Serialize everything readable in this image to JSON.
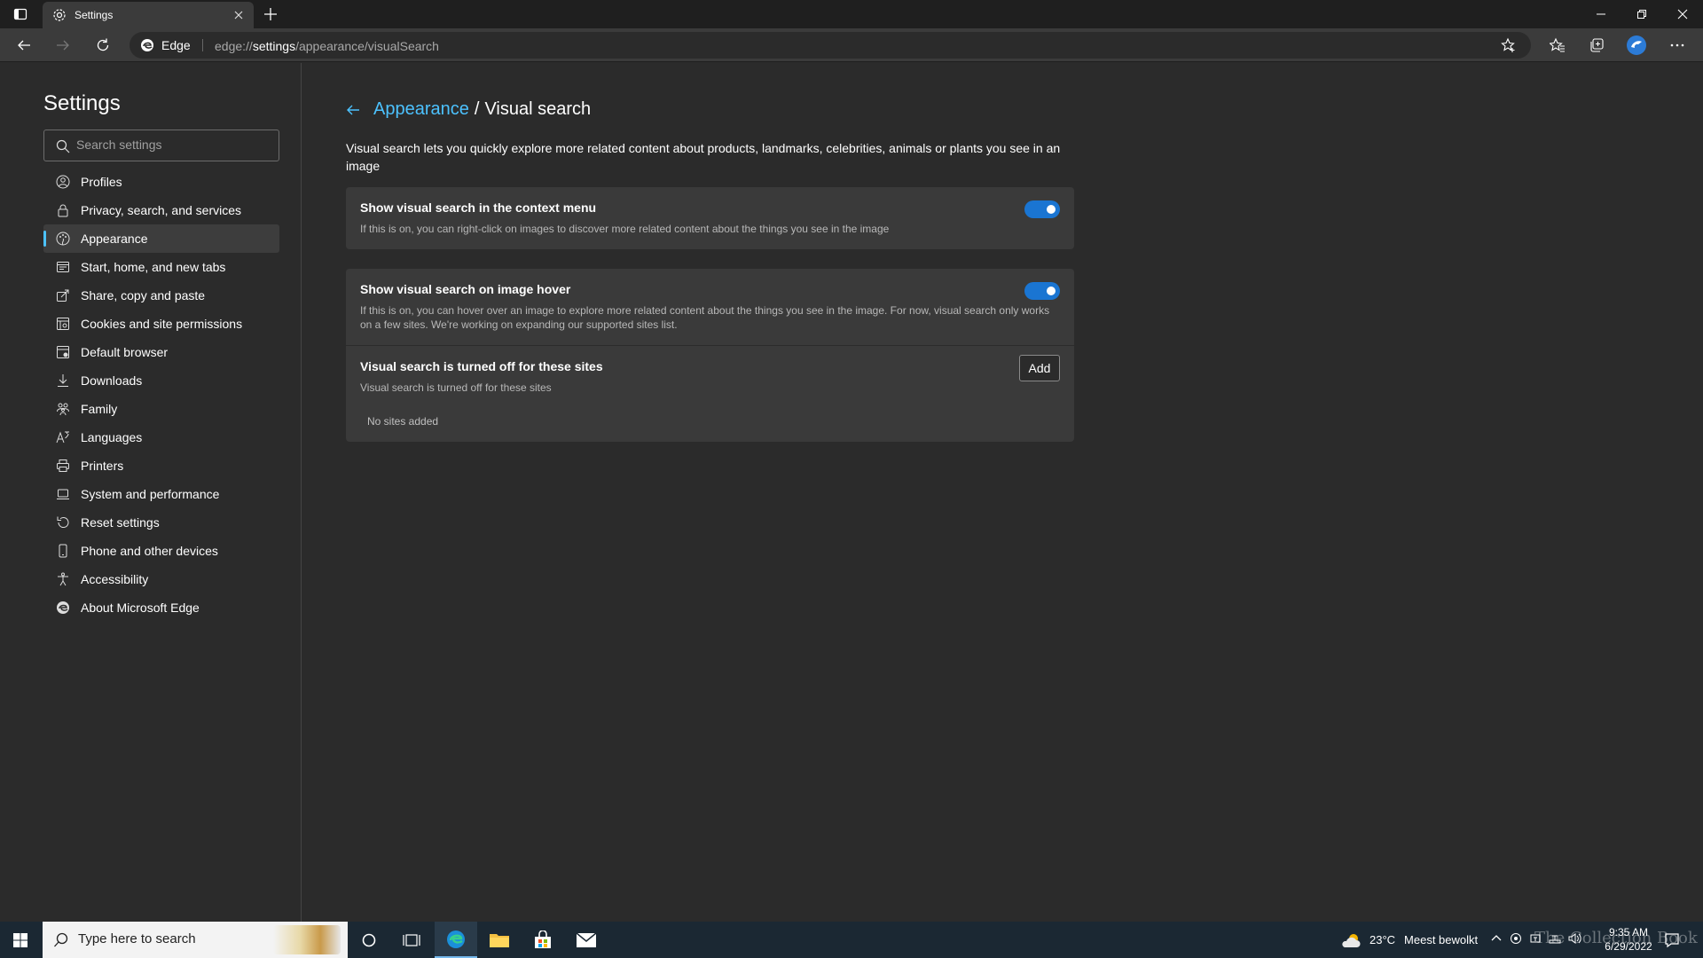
{
  "browser": {
    "tab_title": "Settings",
    "address_chip": "Edge",
    "url_prefix": "edge://",
    "url_host": "settings",
    "url_path": "/appearance/visualSearch"
  },
  "sidebar": {
    "title": "Settings",
    "search_placeholder": "Search settings",
    "items": [
      {
        "label": "Profiles",
        "icon": "profile-icon"
      },
      {
        "label": "Privacy, search, and services",
        "icon": "lock-icon"
      },
      {
        "label": "Appearance",
        "icon": "appearance-icon",
        "active": true
      },
      {
        "label": "Start, home, and new tabs",
        "icon": "home-tab-icon"
      },
      {
        "label": "Share, copy and paste",
        "icon": "share-icon"
      },
      {
        "label": "Cookies and site permissions",
        "icon": "cookies-icon"
      },
      {
        "label": "Default browser",
        "icon": "browser-icon"
      },
      {
        "label": "Downloads",
        "icon": "download-icon"
      },
      {
        "label": "Family",
        "icon": "family-icon"
      },
      {
        "label": "Languages",
        "icon": "languages-icon"
      },
      {
        "label": "Printers",
        "icon": "printer-icon"
      },
      {
        "label": "System and performance",
        "icon": "laptop-icon"
      },
      {
        "label": "Reset settings",
        "icon": "reset-icon"
      },
      {
        "label": "Phone and other devices",
        "icon": "phone-icon"
      },
      {
        "label": "Accessibility",
        "icon": "accessibility-icon"
      },
      {
        "label": "About Microsoft Edge",
        "icon": "edge-icon"
      }
    ]
  },
  "main": {
    "breadcrumb_parent": "Appearance",
    "breadcrumb_separator": "/",
    "breadcrumb_current": "Visual search",
    "description": "Visual search lets you quickly explore more related content about products, landmarks, celebrities, animals or plants you see in an image",
    "context_menu": {
      "title": "Show visual search in the context menu",
      "desc": "If this is on, you can right-click on images to discover more related content about the things you see in the image",
      "enabled": true
    },
    "image_hover": {
      "title": "Show visual search on image hover",
      "desc": "If this is on, you can hover over an image to explore more related content about the things you see in the image. For now, visual search only works on a few sites. We're working on expanding our supported sites list.",
      "enabled": true
    },
    "blocked_sites": {
      "title": "Visual search is turned off for these sites",
      "desc": "Visual search is turned off for these sites",
      "add_label": "Add",
      "empty_text": "No sites added"
    }
  },
  "taskbar": {
    "search_placeholder": "Type here to search",
    "weather_temp": "23°C",
    "weather_text": "Meest bewolkt",
    "time": "9:35 AM",
    "date": "6/29/2022",
    "watermark": "The Collection Book"
  },
  "colors": {
    "accent": "#4cc2ff",
    "toggle_on": "#1a75d2"
  }
}
